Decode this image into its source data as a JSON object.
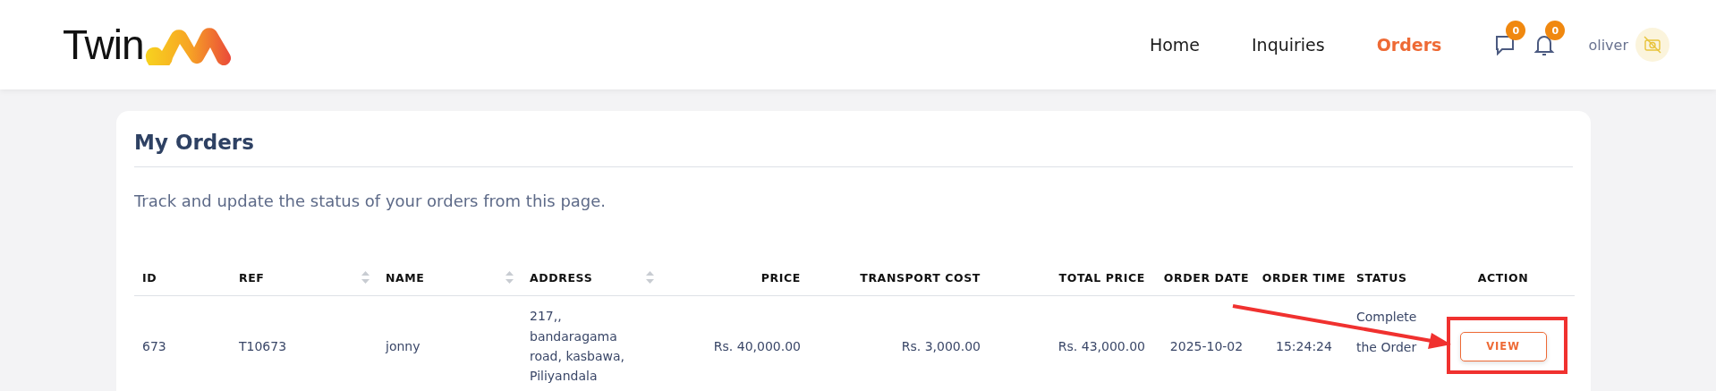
{
  "logo": {
    "text": "Twin"
  },
  "nav": [
    {
      "label": "Home",
      "selected": false
    },
    {
      "label": "Inquiries",
      "selected": false
    },
    {
      "label": "Orders",
      "selected": true
    }
  ],
  "notifications": [
    {
      "kind": "messages",
      "count": "0"
    },
    {
      "kind": "alerts",
      "count": "0"
    }
  ],
  "user": {
    "name": "oliver"
  },
  "page": {
    "title": "My Orders",
    "subtitle": "Track and update the status of your orders from this page."
  },
  "table": {
    "columns": [
      {
        "label": "ID",
        "sortable": false
      },
      {
        "label": "REF",
        "sortable": true
      },
      {
        "label": "NAME",
        "sortable": true
      },
      {
        "label": "ADDRESS",
        "sortable": true
      },
      {
        "label": "PRICE",
        "sortable": false
      },
      {
        "label": "TRANSPORT COST",
        "sortable": false
      },
      {
        "label": "TOTAL PRICE",
        "sortable": false
      },
      {
        "label": "ORDER DATE",
        "sortable": false
      },
      {
        "label": "ORDER TIME",
        "sortable": false
      },
      {
        "label": "STATUS",
        "sortable": false
      },
      {
        "label": "ACTION",
        "sortable": false
      }
    ],
    "rows": [
      {
        "cells": [
          "673",
          "T10673",
          "jonny",
          "217,, bandaragama road, kasbawa, Piliyandala",
          "Rs. 40,000.00",
          "Rs. 3,000.00",
          "Rs. 43,000.00",
          "2025-10-02",
          "15:24:24",
          "Complete the Order"
        ],
        "action": "VIEW"
      }
    ]
  }
}
